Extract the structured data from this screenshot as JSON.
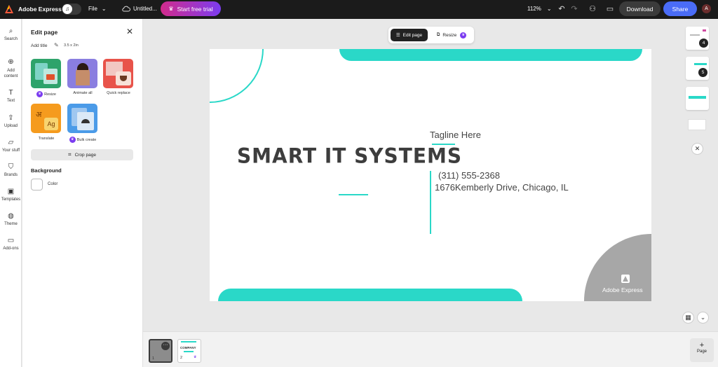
{
  "topbar": {
    "app_name": "Adobe Express",
    "file_menu": "File",
    "doc_title": "Untitled...",
    "trial_button": "Start free trial",
    "zoom": "112%",
    "download": "Download",
    "share": "Share",
    "avatar_initial": "A",
    "brand_color": "#4a6cf7"
  },
  "rail": {
    "items": [
      {
        "label": "Search",
        "icon": "search-icon"
      },
      {
        "label": "Add content",
        "icon": "plus-circle-icon"
      },
      {
        "label": "Text",
        "icon": "text-icon"
      },
      {
        "label": "Upload",
        "icon": "upload-icon"
      },
      {
        "label": "Your stuff",
        "icon": "folder-icon"
      },
      {
        "label": "Brands",
        "icon": "brand-icon"
      },
      {
        "label": "Templates",
        "icon": "templates-icon"
      },
      {
        "label": "Theme",
        "icon": "palette-icon"
      },
      {
        "label": "Add-ons",
        "icon": "addons-icon"
      }
    ]
  },
  "panel": {
    "title": "Edit page",
    "add_title": "Add title",
    "dimensions": "3.5 x 2in",
    "tools": [
      {
        "label": "Resize",
        "premium": true
      },
      {
        "label": "Animate all",
        "premium": false
      },
      {
        "label": "Quick replace",
        "premium": false
      },
      {
        "label": "Translate",
        "premium": false
      },
      {
        "label": "Bulk create",
        "premium": true
      }
    ],
    "crop_page": "Crop page",
    "background_heading": "Background",
    "color_label": "Color"
  },
  "canvas": {
    "edit_page_btn": "Edit page",
    "resize_btn": "Resize",
    "title": "SMART IT SYSTEMS",
    "tagline": "Tagline Here",
    "phone": "(311) 555-2368",
    "address": "1676Kemberly Drive, Chicago, IL",
    "watermark": "Adobe Express",
    "accent_color": "#2ad8c8"
  },
  "right_rail": {
    "page_badges": [
      "4",
      "5"
    ]
  },
  "bottom": {
    "pages": [
      "1",
      "2"
    ],
    "add_page": "Page",
    "thumb_company": "COMPANY"
  }
}
